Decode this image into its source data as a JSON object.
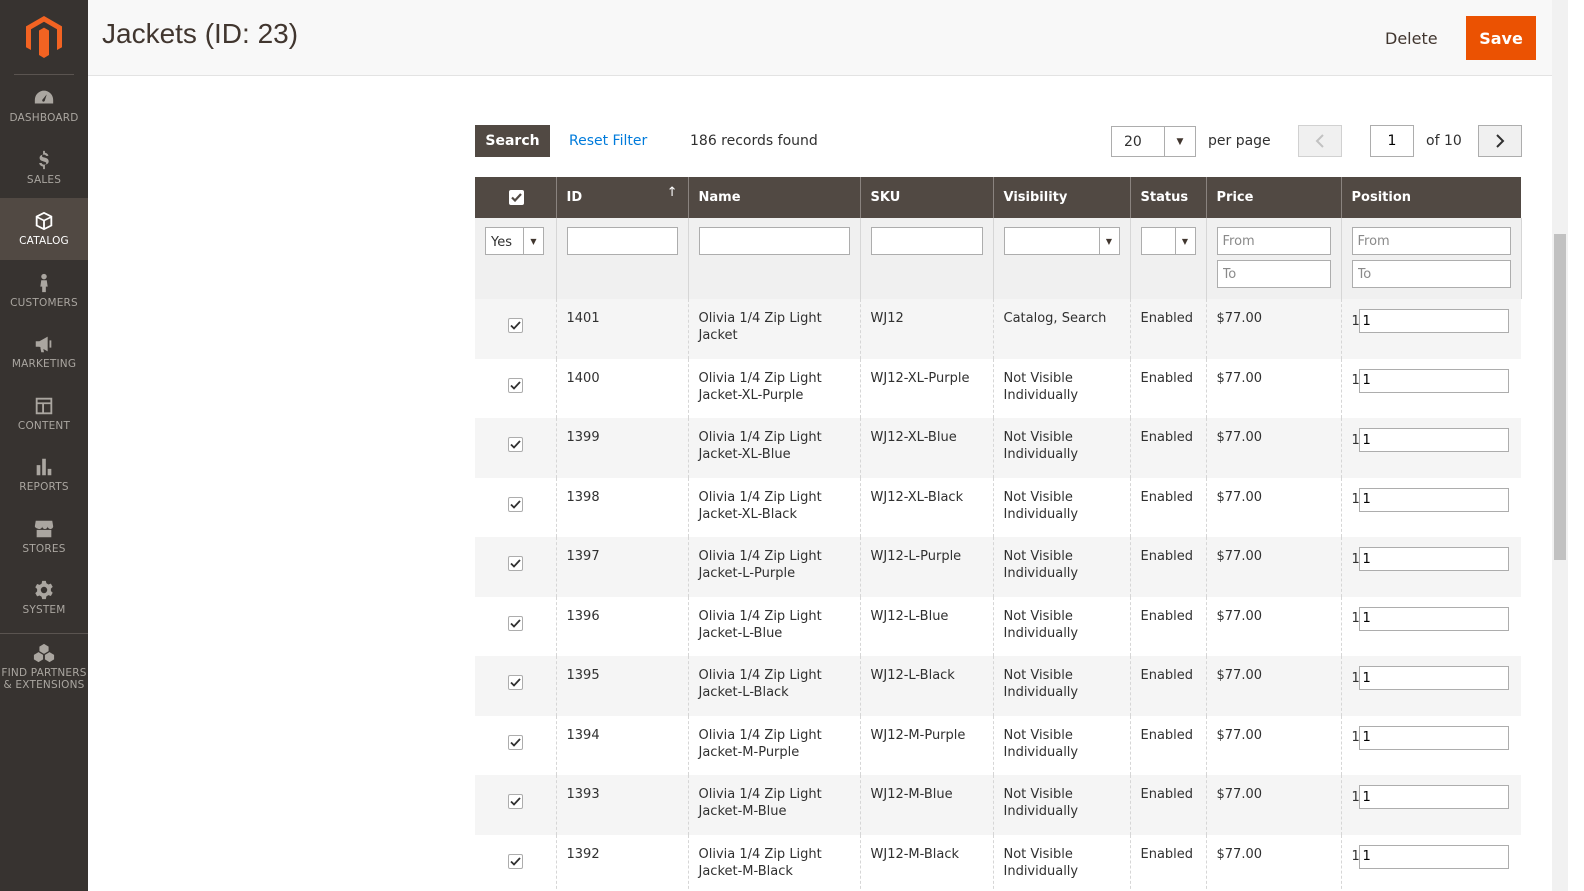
{
  "sidebar": {
    "items": [
      {
        "label": "DASHBOARD",
        "icon": "dashboard-icon"
      },
      {
        "label": "SALES",
        "icon": "dollar-icon"
      },
      {
        "label": "CATALOG",
        "icon": "box-icon",
        "active": true
      },
      {
        "label": "CUSTOMERS",
        "icon": "person-icon"
      },
      {
        "label": "MARKETING",
        "icon": "megaphone-icon"
      },
      {
        "label": "CONTENT",
        "icon": "layout-icon"
      },
      {
        "label": "REPORTS",
        "icon": "bar-chart-icon"
      },
      {
        "label": "STORES",
        "icon": "storefront-icon"
      },
      {
        "label": "SYSTEM",
        "icon": "gear-icon"
      }
    ],
    "partners_label": "FIND PARTNERS & EXTENSIONS"
  },
  "header": {
    "title": "Jackets (ID: 23)",
    "delete_label": "Delete",
    "save_label": "Save"
  },
  "toolbar": {
    "search_label": "Search",
    "reset_label": "Reset Filter",
    "records_found": "186 records found",
    "per_page_value": "20",
    "per_page_label": "per page",
    "current_page": "1",
    "total_pages": "of 10"
  },
  "grid": {
    "columns": [
      "ID",
      "Name",
      "SKU",
      "Visibility",
      "Status",
      "Price",
      "Position"
    ],
    "filters": {
      "in_category": "Yes",
      "from_placeholder": "From",
      "to_placeholder": "To"
    },
    "rows": [
      {
        "id": "1401",
        "name": "Olivia 1/4 Zip Light Jacket",
        "sku": "WJ12",
        "visibility": "Catalog, Search",
        "status": "Enabled",
        "price": "$77.00",
        "pos_prefix": "1",
        "position": "1"
      },
      {
        "id": "1400",
        "name": "Olivia 1/4 Zip Light Jacket-XL-Purple",
        "sku": "WJ12-XL-Purple",
        "visibility": "Not Visible Individually",
        "status": "Enabled",
        "price": "$77.00",
        "pos_prefix": "1",
        "position": "1"
      },
      {
        "id": "1399",
        "name": "Olivia 1/4 Zip Light Jacket-XL-Blue",
        "sku": "WJ12-XL-Blue",
        "visibility": "Not Visible Individually",
        "status": "Enabled",
        "price": "$77.00",
        "pos_prefix": "1",
        "position": "1"
      },
      {
        "id": "1398",
        "name": "Olivia 1/4 Zip Light Jacket-XL-Black",
        "sku": "WJ12-XL-Black",
        "visibility": "Not Visible Individually",
        "status": "Enabled",
        "price": "$77.00",
        "pos_prefix": "1",
        "position": "1"
      },
      {
        "id": "1397",
        "name": "Olivia 1/4 Zip Light Jacket-L-Purple",
        "sku": "WJ12-L-Purple",
        "visibility": "Not Visible Individually",
        "status": "Enabled",
        "price": "$77.00",
        "pos_prefix": "1",
        "position": "1"
      },
      {
        "id": "1396",
        "name": "Olivia 1/4 Zip Light Jacket-L-Blue",
        "sku": "WJ12-L-Blue",
        "visibility": "Not Visible Individually",
        "status": "Enabled",
        "price": "$77.00",
        "pos_prefix": "1",
        "position": "1"
      },
      {
        "id": "1395",
        "name": "Olivia 1/4 Zip Light Jacket-L-Black",
        "sku": "WJ12-L-Black",
        "visibility": "Not Visible Individually",
        "status": "Enabled",
        "price": "$77.00",
        "pos_prefix": "1",
        "position": "1"
      },
      {
        "id": "1394",
        "name": "Olivia 1/4 Zip Light Jacket-M-Purple",
        "sku": "WJ12-M-Purple",
        "visibility": "Not Visible Individually",
        "status": "Enabled",
        "price": "$77.00",
        "pos_prefix": "1",
        "position": "1"
      },
      {
        "id": "1393",
        "name": "Olivia 1/4 Zip Light Jacket-M-Blue",
        "sku": "WJ12-M-Blue",
        "visibility": "Not Visible Individually",
        "status": "Enabled",
        "price": "$77.00",
        "pos_prefix": "1",
        "position": "1"
      },
      {
        "id": "1392",
        "name": "Olivia 1/4 Zip Light Jacket-M-Black",
        "sku": "WJ12-M-Black",
        "visibility": "Not Visible Individually",
        "status": "Enabled",
        "price": "$77.00",
        "pos_prefix": "1",
        "position": "1"
      }
    ]
  },
  "colors": {
    "accent": "#eb5202",
    "sidebar_bg": "#373330",
    "header_row": "#514943",
    "link": "#007bdb"
  }
}
